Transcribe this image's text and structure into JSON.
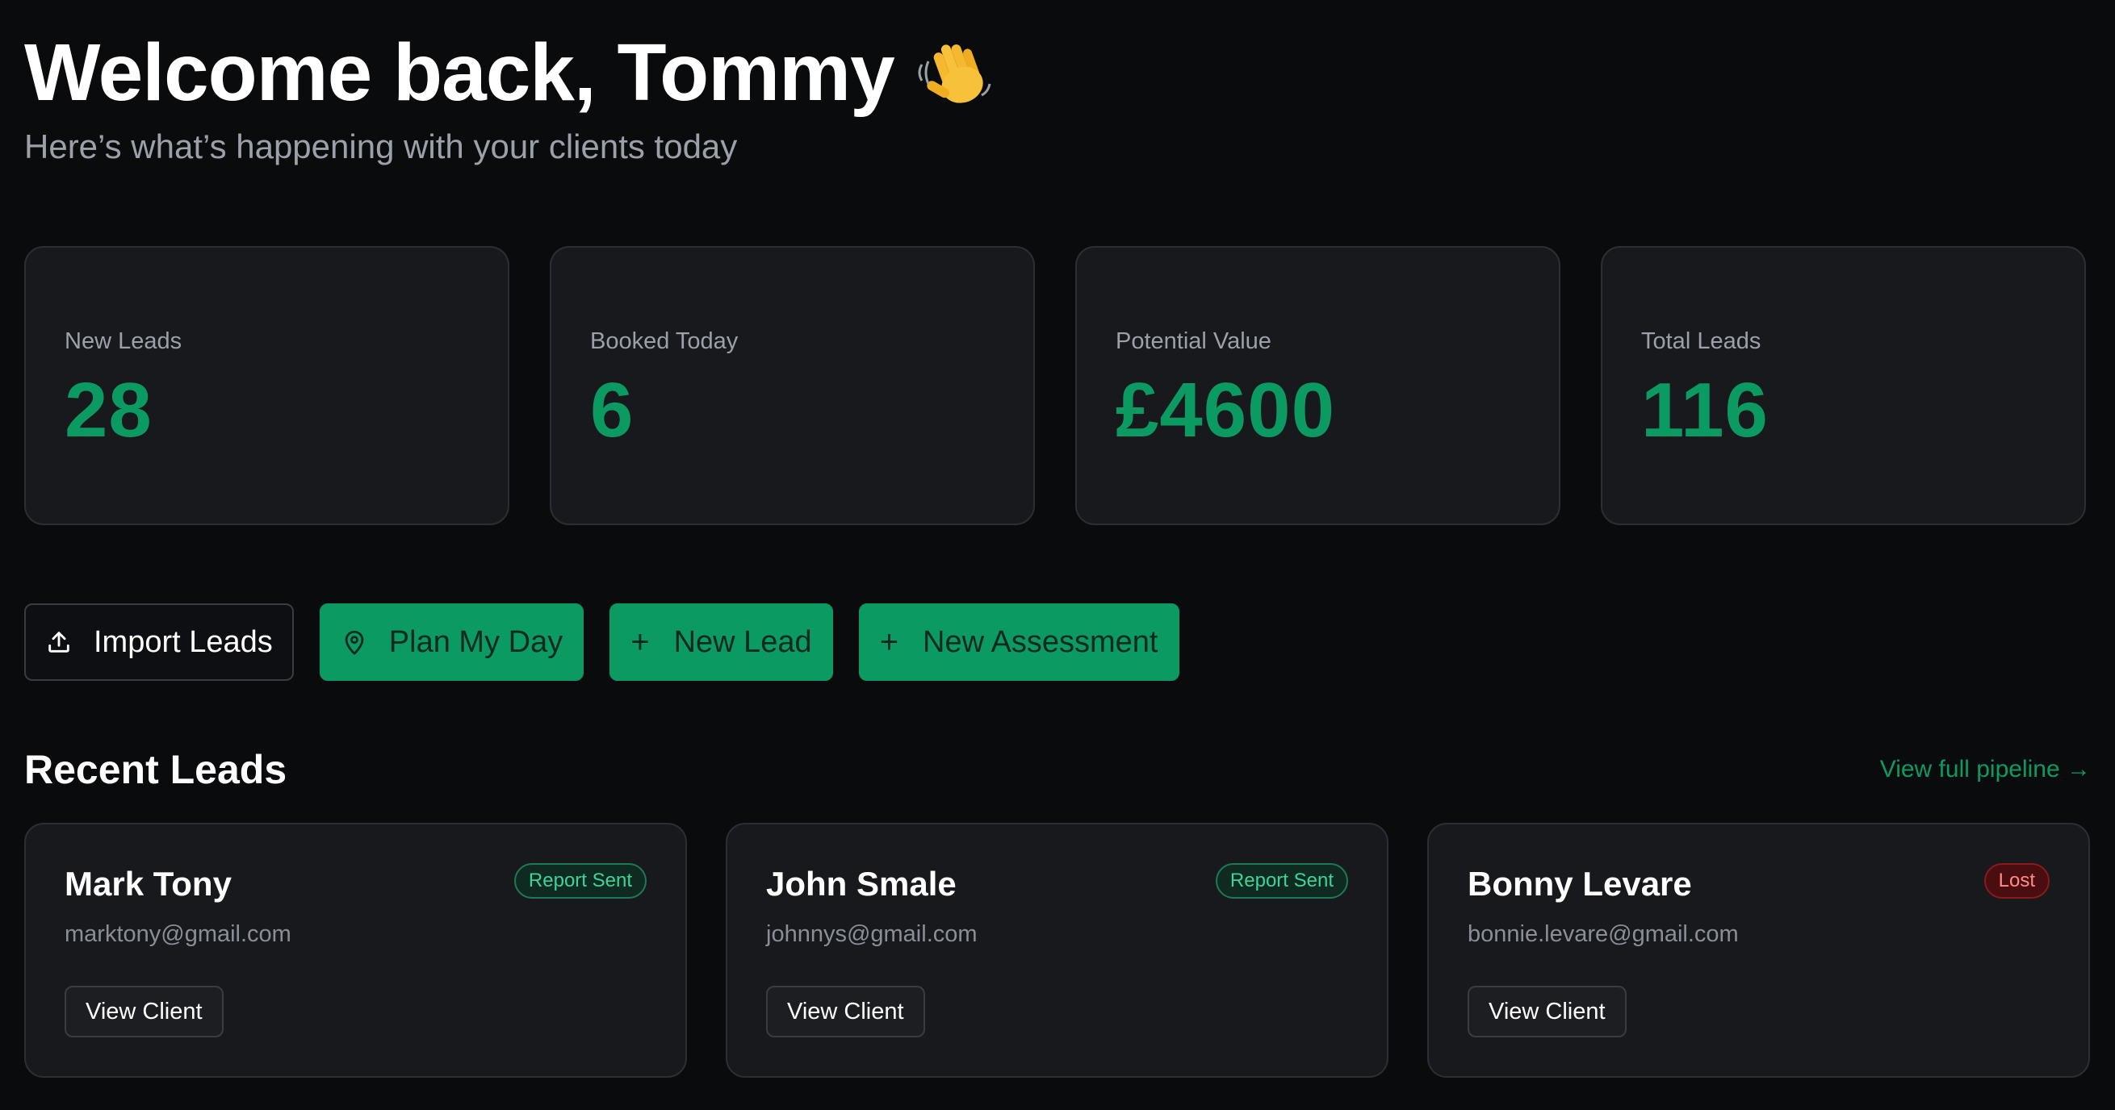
{
  "header": {
    "welcome": "Welcome back, Tommy",
    "wave_emoji": "👋",
    "subtitle": "Here’s what’s happening with your clients today"
  },
  "stats": [
    {
      "label": "New Leads",
      "value": "28"
    },
    {
      "label": "Booked Today",
      "value": "6"
    },
    {
      "label": "Potential Value",
      "value": "£4600"
    },
    {
      "label": "Total Leads",
      "value": "116"
    }
  ],
  "actions": {
    "import": {
      "label": "Import Leads",
      "icon": "upload-icon"
    },
    "plan": {
      "label": "Plan My Day",
      "icon": "map-pin-icon"
    },
    "new_lead": {
      "label": "New Lead",
      "icon": "plus-icon"
    },
    "new_assessment": {
      "label": "New Assessment",
      "icon": "plus-icon"
    }
  },
  "recent": {
    "title": "Recent Leads",
    "view_all": "View full pipeline →",
    "leads": [
      {
        "name": "Mark Tony",
        "email": "marktony@gmail.com",
        "status": "Report Sent",
        "button": "View Client"
      },
      {
        "name": "John Smale",
        "email": "johnnys@gmail.com",
        "status": "Report Sent",
        "button": "View Client"
      },
      {
        "name": "Bonny Levare",
        "email": "bonnie.levare@gmail.com",
        "status": "Lost",
        "button": "View Client"
      }
    ]
  },
  "colors": {
    "background": "#0a0b0d",
    "card": "#18191d",
    "accent_green": "#0c9a63",
    "muted_text": "#9ca0a8",
    "lost_red": "#8a1a1e"
  }
}
